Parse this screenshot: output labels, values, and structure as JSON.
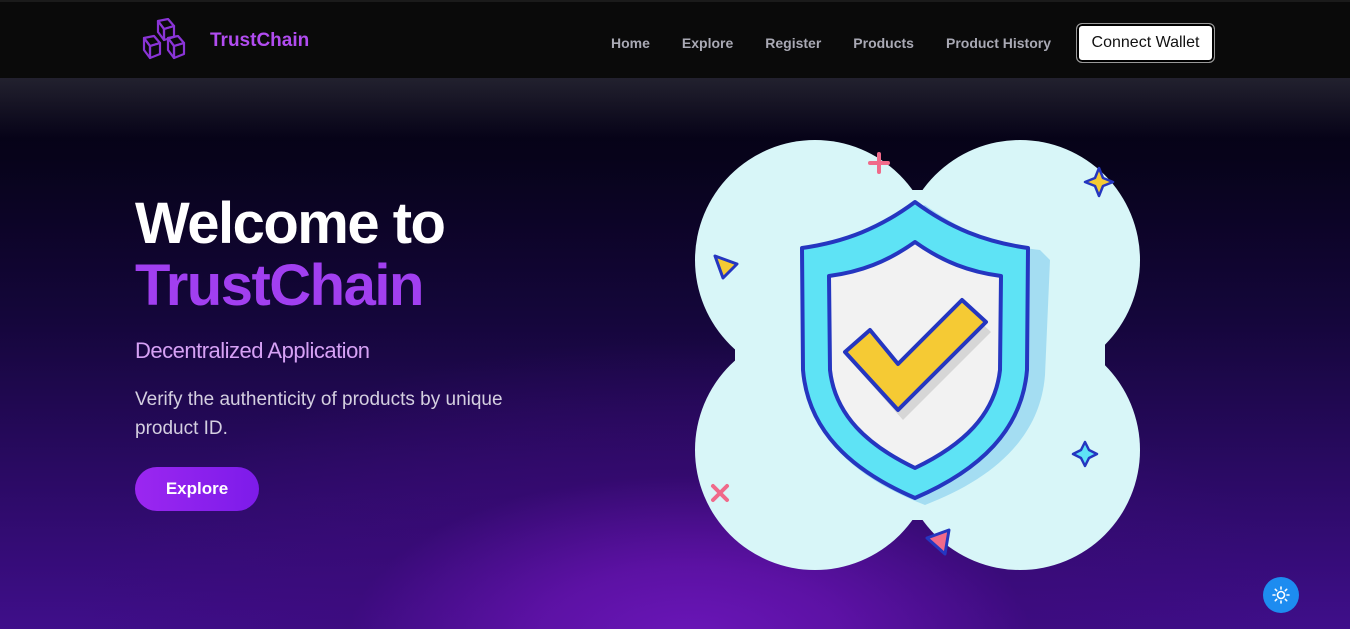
{
  "nav": {
    "brand": "TrustChain",
    "links": [
      "Home",
      "Explore",
      "Register",
      "Products",
      "Product History"
    ],
    "connect_wallet": "Connect Wallet"
  },
  "hero": {
    "title_line1": "Welcome to",
    "title_line2": "TrustChain",
    "subtitle": "Decentralized Application",
    "description": "Verify the authenticity of products by unique product ID.",
    "cta": "Explore"
  },
  "icons": {
    "logo": "cubes-logo-icon",
    "illustration": "shield-check-icon",
    "theme_toggle": "sun-icon"
  },
  "colors": {
    "brand_purple": "#b14cf0",
    "title_purple": "#a13ff0",
    "subtitle_pink": "#d6a1f5",
    "toggle_blue": "#1d8cf0"
  }
}
